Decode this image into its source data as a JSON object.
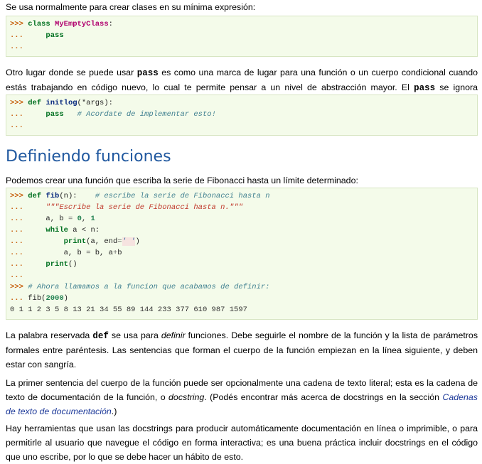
{
  "p1": "Se usa normalmente para crear clases en su mínima expresión:",
  "code1": {
    "l1_prompt": ">>> ",
    "l1_kw": "class",
    "l1_name": "MyEmptyClass",
    "l1_rest": ":",
    "l2_prompt": "...     ",
    "l2_kw": "pass",
    "l3_prompt": "..."
  },
  "p2": {
    "a": "Otro lugar donde se puede usar ",
    "code_a": "pass",
    "b": " es como una marca de lugar para una función o un cuerpo condicional cuando estás trabajando en código nuevo, lo cual te permite pensar a un nivel de abstracción mayor. El ",
    "code_b": "pass",
    "c": " se ignora silenciosamente:"
  },
  "code2": {
    "l1_prompt": ">>> ",
    "l1_kw": "def",
    "l1_name": "initlog",
    "l1_rest": "(*args):",
    "l2_prompt": "...     ",
    "l2_kw": "pass",
    "l2_sp": "   ",
    "l2_comment": "# Acordate de implementar esto!",
    "l3_prompt": "..."
  },
  "heading": "Definiendo funciones",
  "p3": "Podemos crear una función que escriba la serie de Fibonacci hasta un límite determinado:",
  "code3": {
    "l1_prompt": ">>> ",
    "l1_kw": "def",
    "l1_name": "fib",
    "l1_rest": "(n):    ",
    "l1_comment": "# escribe la serie de Fibonacci hasta n",
    "l2_prompt": "...     ",
    "l2_str": "\"\"\"Escribe la serie de Fibonacci hasta n.\"\"\"",
    "l3_prompt": "...     ",
    "l3_a": "a, b ",
    "l3_eq": "=",
    "l3_sp": " ",
    "l3_n0": "0",
    "l3_comma": ", ",
    "l3_n1": "1",
    "l4_prompt": "...     ",
    "l4_kw": "while",
    "l4_rest": " a < n:",
    "l5_prompt": "...         ",
    "l5_fn": "print",
    "l5_a": "(a, end",
    "l5_eq": "=",
    "l5_str": "' '",
    "l5_b": ")",
    "l6_prompt": "...         ",
    "l6_a": "a, b ",
    "l6_eq": "=",
    "l6_b": " b, a",
    "l6_plus": "+",
    "l6_c": "b",
    "l7_prompt": "...     ",
    "l7_fn": "print",
    "l7_rest": "()",
    "l8_prompt": "...",
    "l9_prompt": ">>> ",
    "l9_comment": "# Ahora llamamos a la funcion que acabamos de definir:",
    "l10_prompt": "... ",
    "l10_a": "fib(",
    "l10_num": "2000",
    "l10_b": ")",
    "l11_output": "0 1 1 2 3 5 8 13 21 34 55 89 144 233 377 610 987 1597"
  },
  "p4": {
    "a": "La palabra reservada ",
    "code": "def",
    "b": " se usa para ",
    "em": "definir",
    "c": " funciones. Debe seguirle el nombre de la función y la lista de parámetros formales entre paréntesis. Las sentencias que forman el cuerpo de la función empiezan en la línea siguiente, y deben estar con sangría."
  },
  "p5": {
    "a": "La primer sentencia del cuerpo de la función puede ser opcionalmente una cadena de texto literal; esta es la cadena de texto de documentación de la función, o ",
    "em": "docstring",
    "b": ". (Podés encontrar más acerca de docstrings en la sección ",
    "link": "Cadenas de texto de documentación",
    "c": ".)"
  },
  "p6": "Hay herramientas que usan las docstrings para producir automáticamente documentación en línea o imprimible, o para permitirle al usuario que navegue el código en forma interactiva; es una buena práctica incluir docstrings en el código que uno escribe, por lo que se debe hacer un hábito de esto."
}
